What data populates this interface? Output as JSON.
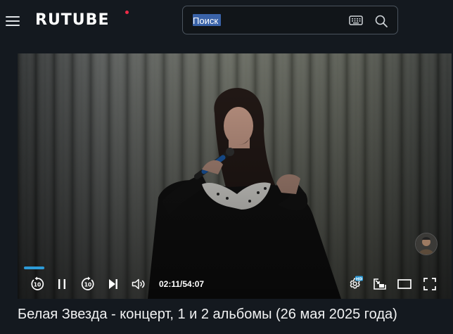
{
  "header": {
    "logo_text": "RUTUBE",
    "brand_dot_color": "#ee2b47",
    "menu_icon": "hamburger-menu-icon",
    "search": {
      "placeholder": "Поиск",
      "value": "",
      "keyboard_icon": "keyboard-icon",
      "search_icon": "search-icon"
    }
  },
  "player": {
    "current_time": "02:11",
    "separator": "/",
    "duration": "54:07",
    "progress_fraction": 0.04,
    "progress_color": "#2d9bd8",
    "controls": {
      "rewind_icon": "rewind-10-icon",
      "pause_icon": "pause-icon",
      "forward_icon": "forward-10-icon",
      "next_icon": "next-icon",
      "volume_icon": "volume-icon",
      "settings_icon": "settings-hd-icon",
      "settings_badge": "HD",
      "pip_icon": "picture-in-picture-icon",
      "theater_icon": "theater-mode-icon",
      "fullscreen_icon": "fullscreen-icon"
    }
  },
  "video": {
    "title": "Белая Звезда - концерт, 1 и 2 альбомы (26 мая 2025 года)"
  }
}
